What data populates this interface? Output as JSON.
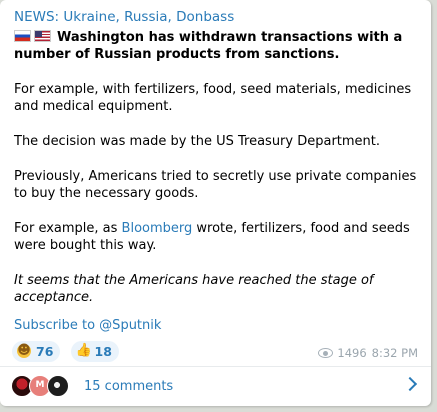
{
  "channel": {
    "title": "NEWS: Ukraine, Russia, Donbass"
  },
  "post": {
    "headline": "Washington has withdrawn transactions with a number of Russian products from sanctions.",
    "paragraph_1": "For example, with fertilizers, food, seed materials, medicines and medical equipment.",
    "paragraph_2": "The decision was made by the US Treasury Department.",
    "paragraph_3": "Previously, Americans tried to secretly use private companies to buy the necessary goods.",
    "paragraph_4_prefix": "For example, as ",
    "paragraph_4_link": "Bloomberg",
    "paragraph_4_suffix": " wrote, fertilizers, food and seeds were bought this way.",
    "paragraph_5": "It seems that the Americans have reached the stage of acceptance.",
    "subscribe": "Subscribe to @Sputnik"
  },
  "reactions": [
    {
      "emoji": "smile-emoji",
      "count": "76"
    },
    {
      "emoji": "thumbs-up-emoji",
      "count": "18"
    }
  ],
  "meta": {
    "views": "1496",
    "time": "8:32 PM"
  },
  "comments": {
    "label": "15 comments",
    "avatar_letter": "M"
  },
  "colors": {
    "accent": "#2a7bb8",
    "background": "#d9dcd6",
    "reaction_bg": "#eaf3fb"
  }
}
